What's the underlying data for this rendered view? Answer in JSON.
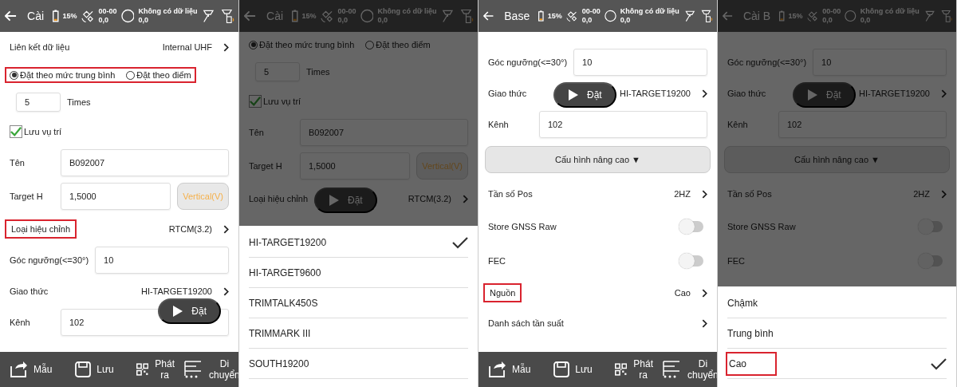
{
  "panels": [
    {
      "title": "Cài",
      "dimmed": false,
      "scrolled": false,
      "status": {
        "battery": "15%",
        "sats": "00-00",
        "sats_value": "0,0",
        "fix": "Không có dữ liệu",
        "fix_value": "0,0"
      },
      "rows": [
        {
          "kind": "link",
          "label": "Liên kết dữ liệu",
          "value": "Internal UHF"
        },
        {
          "kind": "radio",
          "highlighted": true,
          "options": [
            {
              "label": "Đặt theo mức trung bình",
              "selected": true
            },
            {
              "label": "Đặt theo điểm",
              "selected": false
            }
          ]
        },
        {
          "kind": "count",
          "value": "5",
          "unit": "Times"
        },
        {
          "kind": "check",
          "label": "Lưu vụ trí",
          "checked": true
        },
        {
          "kind": "field",
          "label": "Tên",
          "value": "B092007"
        },
        {
          "kind": "field_button",
          "label": "Target H",
          "value": "1,5000",
          "button": "Vertical(V)",
          "disabled": true
        },
        {
          "kind": "link",
          "label": "Loại hiệu chỉnh",
          "value": "RTCM(3.2)",
          "highlighted": true
        },
        {
          "kind": "field",
          "label": "Góc ngưỡng(<=30°)",
          "value": "10"
        },
        {
          "kind": "link",
          "label": "Giao thức",
          "value": "HI-TARGET19200"
        },
        {
          "kind": "field",
          "label": "Kênh",
          "value": "102",
          "play": {
            "label": "Đặt"
          }
        }
      ],
      "toolbar": [
        {
          "kind": "template",
          "label": "Mẫu"
        },
        {
          "kind": "save",
          "label": "Lưu"
        },
        {
          "kind": "qr",
          "label": "Phát ra"
        },
        {
          "kind": "move",
          "label": "Di chuyển"
        }
      ]
    },
    {
      "title": "Cài",
      "dimmed": true,
      "scrolled": false,
      "status": {
        "battery": "15%",
        "sats": "00-00",
        "sats_value": "0,0",
        "fix": "Không có dữ liệu",
        "fix_value": "0,0"
      },
      "rows": [
        {
          "kind": "radio",
          "options": [
            {
              "label": "Đặt theo mức trung bình",
              "selected": true
            },
            {
              "label": "Đặt theo điểm",
              "selected": false
            }
          ]
        },
        {
          "kind": "count",
          "value": "5",
          "unit": "Times"
        },
        {
          "kind": "check",
          "label": "Lưu vụ trí",
          "checked": true
        },
        {
          "kind": "field",
          "label": "Tên",
          "value": "B092007"
        },
        {
          "kind": "field_button",
          "label": "Target H",
          "value": "1,5000",
          "button": "Vertical(V)",
          "disabled": true
        },
        {
          "kind": "link",
          "label": "Loại hiệu chỉnh",
          "value": "RTCM(3.2)",
          "play": {
            "label": "Đặt"
          }
        }
      ],
      "sheet": [
        {
          "label": "HI-TARGET19200",
          "selected": true
        },
        {
          "label": "HI-TARGET9600",
          "selected": false
        },
        {
          "label": "TRIMTALK450S",
          "selected": false
        },
        {
          "label": "TRIMMARK III",
          "selected": false
        },
        {
          "label": "SOUTH19200",
          "selected": false
        }
      ]
    },
    {
      "title": "Base",
      "dimmed": false,
      "scrolled": true,
      "status": {
        "battery": "15%",
        "sats": "00-00",
        "sats_value": "0,0",
        "fix": "Không có dữ liệu",
        "fix_value": "0,0"
      },
      "rows": [
        {
          "kind": "field",
          "label": "Góc ngưỡng(<=30°)",
          "value": "10"
        },
        {
          "kind": "link",
          "label": "Giao thức",
          "value": "HI-TARGET19200",
          "play": {
            "label": "Đặt"
          }
        },
        {
          "kind": "field",
          "label": "Kênh",
          "value": "102"
        },
        {
          "kind": "button",
          "label": "Cấu hình nâng cao ▼"
        },
        {
          "kind": "link",
          "label": "Tần số Pos",
          "value": "2HZ"
        },
        {
          "kind": "toggle",
          "label": "Store GNSS Raw",
          "on": false
        },
        {
          "kind": "toggle",
          "label": "FEC",
          "on": false
        },
        {
          "kind": "link",
          "label": "Nguồn",
          "value": "Cao",
          "highlighted": true
        },
        {
          "kind": "link",
          "label": "Danh sách tần suất"
        }
      ],
      "toolbar": [
        {
          "kind": "template",
          "label": "Mẫu"
        },
        {
          "kind": "save",
          "label": "Lưu"
        },
        {
          "kind": "qr",
          "label": "Phát ra"
        },
        {
          "kind": "move",
          "label": "Di chuyển"
        }
      ]
    },
    {
      "title": "Cài B",
      "dimmed": true,
      "scrolled": true,
      "status": {
        "battery": "15%",
        "sats": "00-00",
        "sats_value": "0,0",
        "fix": "Không có dữ liệu",
        "fix_value": "0,0"
      },
      "rows": [
        {
          "kind": "field",
          "label": "Góc ngưỡng(<=30°)",
          "value": "10"
        },
        {
          "kind": "link",
          "label": "Giao thức",
          "value": "HI-TARGET19200",
          "play": {
            "label": "Đặt"
          }
        },
        {
          "kind": "field",
          "label": "Kênh",
          "value": "102"
        },
        {
          "kind": "button",
          "label": "Cấu hình nâng cao ▼"
        },
        {
          "kind": "link",
          "label": "Tần số Pos",
          "value": "2HZ"
        },
        {
          "kind": "toggle",
          "label": "Store GNSS Raw",
          "on": false
        },
        {
          "kind": "toggle",
          "label": "FEC",
          "on": false
        }
      ],
      "sheet": [
        {
          "label": "Chậmk",
          "selected": false
        },
        {
          "label": "Trung bình",
          "selected": false
        },
        {
          "label": "Cao",
          "selected": true,
          "highlighted": true
        }
      ]
    }
  ]
}
